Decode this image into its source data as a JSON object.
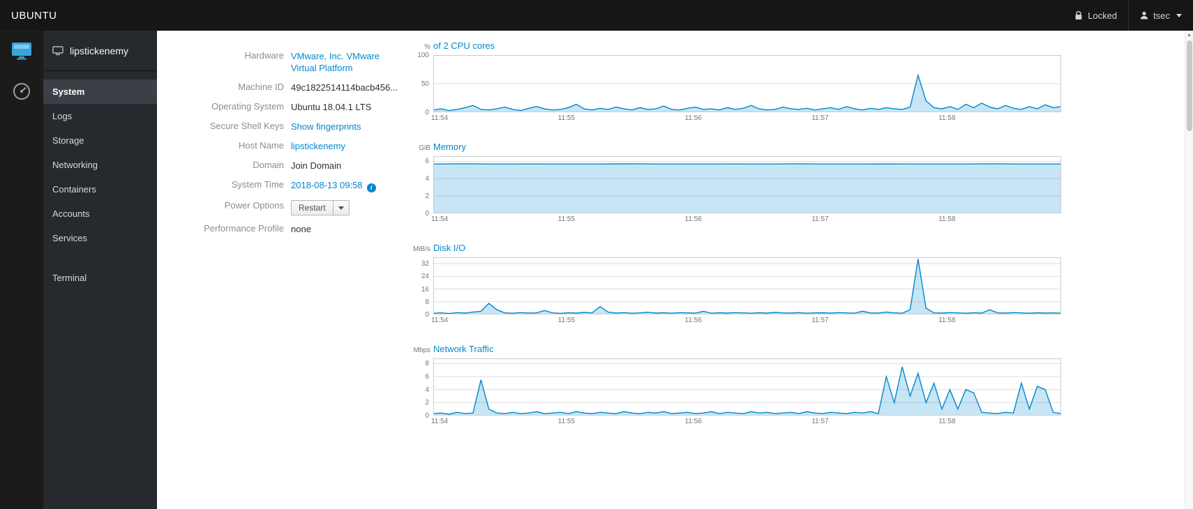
{
  "colors": {
    "link": "#0088ce",
    "chart_line": "#0088ce",
    "chart_fill": "rgba(0,136,206,0.22)",
    "chart_grid": "#dddddd",
    "chart_border": "#cccccc"
  },
  "topbar": {
    "brand": "UBUNTU",
    "locked_label": "Locked",
    "user": "tsec"
  },
  "sidebar": {
    "hostname": "lipstickenemy",
    "items": [
      {
        "label": "System",
        "active": true
      },
      {
        "label": "Logs"
      },
      {
        "label": "Storage"
      },
      {
        "label": "Networking"
      },
      {
        "label": "Containers"
      },
      {
        "label": "Accounts"
      },
      {
        "label": "Services"
      }
    ],
    "secondary_items": [
      {
        "label": "Terminal"
      }
    ]
  },
  "system_info": {
    "rows": [
      {
        "label": "Hardware",
        "value": "VMware, Inc. VMware Virtual Platform",
        "kind": "link"
      },
      {
        "label": "Machine ID",
        "value": "49c1822514114bacb456...",
        "kind": "text"
      },
      {
        "label": "Operating System",
        "value": "Ubuntu 18.04.1 LTS",
        "kind": "text"
      },
      {
        "label": "Secure Shell Keys",
        "value": "Show fingerprints",
        "kind": "link"
      },
      {
        "label": "Host Name",
        "value": "lipstickenemy",
        "kind": "link"
      },
      {
        "label": "Domain",
        "value": "Join Domain",
        "kind": "text"
      },
      {
        "label": "System Time",
        "value": "2018-08-13 09:58",
        "kind": "time"
      },
      {
        "label": "Power Options",
        "value": "Restart",
        "kind": "power"
      },
      {
        "label": "Performance Profile",
        "value": "none",
        "kind": "text"
      }
    ]
  },
  "chart_data": [
    {
      "type": "area",
      "unit": "%",
      "title": "of 2 CPU cores",
      "x_ticks": [
        "11:54",
        "11:55",
        "11:56",
        "11:57",
        "11:58"
      ],
      "x_total_minutes": 4.95,
      "x_first_tick_offset": 0.05,
      "ylim": [
        0,
        100
      ],
      "yticks": [
        0,
        50,
        100
      ],
      "values": [
        4,
        6,
        3,
        5,
        8,
        12,
        5,
        4,
        6,
        9,
        5,
        3,
        7,
        10,
        6,
        4,
        5,
        8,
        14,
        6,
        4,
        7,
        5,
        9,
        6,
        4,
        8,
        5,
        6,
        11,
        5,
        4,
        7,
        9,
        5,
        6,
        4,
        8,
        5,
        7,
        12,
        6,
        4,
        5,
        9,
        6,
        5,
        7,
        4,
        6,
        8,
        5,
        10,
        6,
        4,
        7,
        5,
        8,
        6,
        5,
        9,
        65,
        20,
        8,
        6,
        10,
        5,
        14,
        8,
        16,
        9,
        6,
        12,
        7,
        5,
        10,
        6,
        13,
        8,
        10
      ]
    },
    {
      "type": "area",
      "unit": "GiB",
      "title": "Memory",
      "x_ticks": [
        "11:54",
        "11:55",
        "11:56",
        "11:57",
        "11:58"
      ],
      "x_total_minutes": 4.95,
      "x_first_tick_offset": 0.05,
      "ylim": [
        0,
        6.6
      ],
      "yticks": [
        0,
        2,
        4,
        6
      ],
      "values": [
        5.7,
        5.72,
        5.7,
        5.71,
        5.7,
        5.7,
        5.72,
        5.7,
        5.7,
        5.71,
        5.7,
        5.72,
        5.7,
        5.7,
        5.71,
        5.7,
        5.7,
        5.72,
        5.7,
        5.7
      ]
    },
    {
      "type": "area",
      "unit": "MiB/s",
      "title": "Disk I/O",
      "x_ticks": [
        "11:54",
        "11:55",
        "11:56",
        "11:57",
        "11:58"
      ],
      "x_total_minutes": 4.95,
      "x_first_tick_offset": 0.05,
      "ylim": [
        0,
        36
      ],
      "yticks": [
        0,
        8,
        16,
        24,
        32
      ],
      "values": [
        0.8,
        1,
        0.6,
        1.2,
        0.9,
        1.5,
        2,
        7,
        3,
        1,
        0.8,
        1.2,
        0.9,
        1,
        2.5,
        1,
        0.7,
        1.1,
        0.9,
        1.3,
        1,
        5,
        1.5,
        0.9,
        1.2,
        0.8,
        1,
        1.4,
        0.9,
        1.1,
        0.8,
        1.2,
        1,
        0.9,
        2,
        0.8,
        1.1,
        0.9,
        1.2,
        1,
        0.8,
        1.1,
        0.9,
        1.3,
        1,
        0.9,
        1.2,
        0.8,
        1,
        1.1,
        0.9,
        1.2,
        1,
        0.8,
        2,
        1,
        0.9,
        1.5,
        1,
        0.8,
        3,
        35,
        4,
        1,
        0.9,
        1.2,
        1,
        0.8,
        1.1,
        0.9,
        3,
        1,
        0.9,
        1.2,
        1,
        0.8,
        1.1,
        0.9,
        1,
        0.8
      ]
    },
    {
      "type": "area",
      "unit": "Mbps",
      "title": "Network Traffic",
      "x_ticks": [
        "11:54",
        "11:55",
        "11:56",
        "11:57",
        "11:58"
      ],
      "x_total_minutes": 4.95,
      "x_first_tick_offset": 0.05,
      "ylim": [
        0,
        8.8
      ],
      "yticks": [
        0,
        2,
        4,
        6,
        8
      ],
      "values": [
        0.3,
        0.4,
        0.2,
        0.5,
        0.3,
        0.4,
        5.5,
        1,
        0.4,
        0.3,
        0.5,
        0.3,
        0.4,
        0.6,
        0.3,
        0.4,
        0.5,
        0.3,
        0.6,
        0.4,
        0.3,
        0.5,
        0.4,
        0.3,
        0.6,
        0.4,
        0.3,
        0.5,
        0.4,
        0.6,
        0.3,
        0.4,
        0.5,
        0.3,
        0.4,
        0.6,
        0.3,
        0.5,
        0.4,
        0.3,
        0.6,
        0.4,
        0.5,
        0.3,
        0.4,
        0.5,
        0.3,
        0.6,
        0.4,
        0.3,
        0.5,
        0.4,
        0.3,
        0.5,
        0.4,
        0.6,
        0.3,
        6,
        2,
        7.5,
        3,
        6.5,
        2,
        5,
        1,
        4,
        1,
        4,
        3.5,
        0.5,
        0.4,
        0.3,
        0.5,
        0.4,
        5,
        1,
        4.5,
        4,
        0.5,
        0.3
      ]
    }
  ]
}
